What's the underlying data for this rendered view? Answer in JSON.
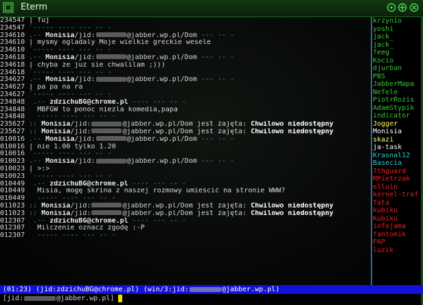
{
  "window": {
    "title": "Eterm"
  },
  "colors": {
    "nick_colors": [
      "#35c935",
      "#35c935",
      "#35c935",
      "#35c935",
      "#35c935",
      "#35c935",
      "#35c935",
      "#35c935",
      "#35c935",
      "#35c935",
      "#35c935",
      "#35c935",
      "#35c935",
      "#ffff66",
      "#ffffff",
      "#ffff66",
      "#ffffff",
      "#35c9c9",
      "#35c9c9",
      "#e02020",
      "#e02020",
      "#e02020",
      "#e02020",
      "#e02020",
      "#e02020",
      "#e02020",
      "#e02020",
      "#e02020",
      "#e02020",
      "#e02020",
      "#e02020",
      "#e02020"
    ]
  },
  "lines": [
    {
      "type": "text",
      "ts": "234547",
      "text": "| fuj"
    },
    {
      "type": "dash",
      "ts": "234547",
      "text": "`----- ---- --- -- -"
    },
    {
      "type": "hdr",
      "ts": "234610",
      "nick": "Monisia",
      "pre": "/jid:",
      "post": "@jabber.wp.pl/Dom",
      "tail": " --- -- -"
    },
    {
      "type": "text",
      "ts": "234610",
      "text": "| mysmy ogladaly Moje wielkie greckie wesele"
    },
    {
      "type": "dash",
      "ts": "234610",
      "text": "`----- ---- --- -- -"
    },
    {
      "type": "hdr",
      "ts": "234618",
      "nick": "Monisia",
      "pre": "/jid:",
      "post": "@jabber.wp.pl/Dom",
      "tail": " --- -- -"
    },
    {
      "type": "text",
      "ts": "234618",
      "text": "| chyba ze juz sie chwalilam ;)))"
    },
    {
      "type": "dash",
      "ts": "234618",
      "text": "`----- ---- --- -- -"
    },
    {
      "type": "hdr",
      "ts": "234627",
      "nick": "Monisia",
      "pre": "/jid:",
      "post": "@jabber.wp.pl/Dom",
      "tail": " --- -- -"
    },
    {
      "type": "text",
      "ts": "234627",
      "text": "| pa pa na ra"
    },
    {
      "type": "dash",
      "ts": "234627",
      "text": "`----- ---- --- -- -"
    },
    {
      "type": "own",
      "ts": "234848",
      "nick": "zdzichuBG@chrome.pl"
    },
    {
      "type": "owntext",
      "ts": "234848",
      "text": "  MBFGW to ponoc niezla komedia,papa"
    },
    {
      "type": "dash",
      "ts": "234848",
      "text": "  ----- ---- --- -- -"
    },
    {
      "type": "status",
      "ts": "235627",
      "nick": "Monisia",
      "pre": "/jid:",
      "post": "@jabber.wp.pl/Dom jest zajęta: ",
      "bold": "Chwilowo niedostępny"
    },
    {
      "type": "status",
      "ts": "235627",
      "nick": "Monisia",
      "pre": "/jid:",
      "post": "@jabber.wp.pl/Dom jest zajęta: ",
      "bold": "Chwilowo niedostępny"
    },
    {
      "type": "hdr",
      "ts": "010016",
      "nick": "Monisia",
      "pre": "/jid:",
      "post": "@jabber.wp.pl/Dom",
      "tail": " --- -- -"
    },
    {
      "type": "text",
      "ts": "010016",
      "text": "| nie 1.00 tylko 1.20"
    },
    {
      "type": "dash",
      "ts": "010016",
      "text": "`----- ---- --- -- -"
    },
    {
      "type": "hdr",
      "ts": "010023",
      "nick": "Monisia",
      "pre": "/jid:",
      "post": "@jabber.wp.pl/Dom",
      "tail": " --- -- -"
    },
    {
      "type": "text",
      "ts": "010023",
      "text": "| >:>"
    },
    {
      "type": "dash",
      "ts": "010023",
      "text": "`----- ---- --- -- -"
    },
    {
      "type": "own",
      "ts": "010449",
      "nick": "zdzichuBG@chrome.pl"
    },
    {
      "type": "owntext",
      "ts": "010449",
      "text": "  Misia, mogę skrina z naszej rozmowy umieścić na stronie WWW?"
    },
    {
      "type": "dash",
      "ts": "010449",
      "text": "  ----- ---- --- -- -"
    },
    {
      "type": "status",
      "ts": "011023",
      "nick": "Monisia",
      "pre": "/jid:",
      "post": "@jabber.wp.pl/Dom jest zajęta: ",
      "bold": "Chwilowo niedostępny"
    },
    {
      "type": "status",
      "ts": "011023",
      "nick": "Monisia",
      "pre": "/jid:",
      "post": "@jabber.wp.pl/Dom jest zajęta: ",
      "bold": "Chwilowo niedostępny"
    },
    {
      "type": "own",
      "ts": "012307",
      "nick": "zdzichuBG@chrome.pl"
    },
    {
      "type": "owntext",
      "ts": "012307",
      "text": "  Milczenie oznacz zgodę :-P"
    },
    {
      "type": "dash",
      "ts": "012307",
      "text": "  ----- ---- --- -- -"
    }
  ],
  "nicklist": [
    "krzynio",
    "yoshi",
    "jack_",
    "jack_",
    "feeg",
    "Kocio",
    "djurban",
    "PBS",
    "JabberMapa",
    "Nefele",
    "PiotrRozis",
    "AdamStypik",
    "indicator",
    "Jogger",
    "Monisia",
    "skazi",
    "ja-task",
    "Krasnal12",
    "Basecia",
    "7thguard",
    "MPietrzak",
    "elluin",
    "kernel-traf",
    "Tata",
    "kubiku",
    "Kubiku",
    "infojama",
    "fantomik",
    "PAP",
    "luzik"
  ],
  "statusbar": {
    "left": "(01:23) (jid:zdzichuBG@chrome.pl) (win/3:jid:",
    "right": "@jabber.wp.pl)"
  },
  "input": {
    "prefix": "[jid:",
    "suffix": "@jabber.wp.pl] "
  }
}
